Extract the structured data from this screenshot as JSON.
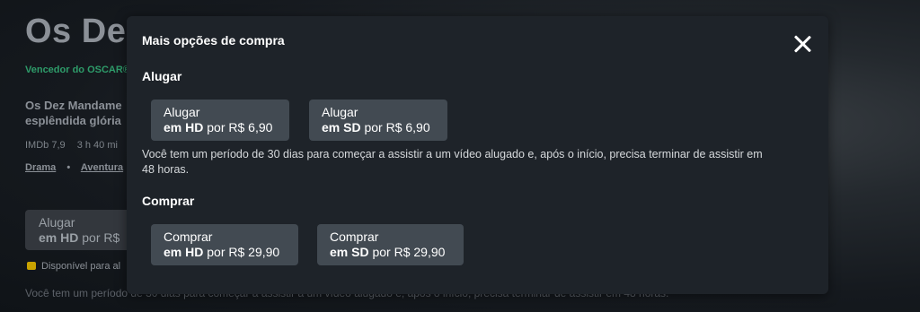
{
  "background": {
    "title": "Os Dez",
    "award": "Vencedor do OSCAR®",
    "description": "Os Dez Mandame esplêndida glória",
    "meta": {
      "imdb": "IMDb 7,9",
      "duration": "3 h 40 mi"
    },
    "genres": [
      "Drama",
      "Aventura"
    ],
    "genre_separator": "•",
    "rent_button": {
      "line1": "Alugar",
      "quality": "em HD",
      "price_prefix": "por R$"
    },
    "available": "Disponível para al",
    "note": "Você tem um período de 30 dias para começar a assistir a um vídeo alugado e, após o início, precisa terminar de assistir em 48 horas."
  },
  "modal": {
    "title": "Mais opções de compra",
    "close_icon": "close-icon",
    "rent": {
      "heading": "Alugar",
      "options": [
        {
          "action": "Alugar",
          "quality": "em HD",
          "price": "por R$ 6,90"
        },
        {
          "action": "Alugar",
          "quality": "em SD",
          "price": "por R$ 6,90"
        }
      ],
      "info": "Você tem um período de 30 dias para começar a assistir a um vídeo alugado e, após o início, precisa terminar de assistir em 48 horas."
    },
    "buy": {
      "heading": "Comprar",
      "options": [
        {
          "action": "Comprar",
          "quality": "em HD",
          "price": "por R$ 29,90"
        },
        {
          "action": "Comprar",
          "quality": "em SD",
          "price": "por R$ 29,90"
        }
      ]
    }
  },
  "colors": {
    "modal_bg": "#1e2329",
    "button_bg": "#424a52",
    "award_green": "#2e9c6a"
  }
}
